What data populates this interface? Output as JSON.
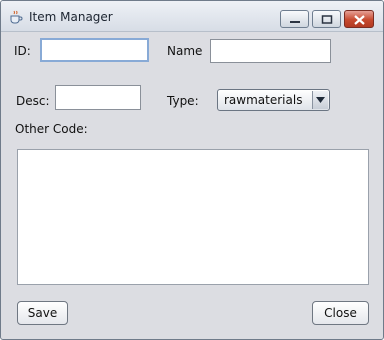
{
  "window": {
    "title": "Item Manager"
  },
  "form": {
    "id_label": "ID:",
    "id_value": "",
    "name_label": "Name",
    "name_value": "",
    "desc_label": "Desc:",
    "desc_value": "",
    "type_label": "Type:",
    "type_value": "rawmaterials",
    "other_code_label": "Other Code:",
    "other_code_value": ""
  },
  "buttons": {
    "save_label": "Save",
    "close_label": "Close"
  },
  "icons": {
    "app": "java-cup-icon",
    "minimize": "minimize-icon",
    "maximize": "maximize-icon",
    "close": "close-icon",
    "dropdown": "chevron-down-icon"
  },
  "colors": {
    "close_button": "#c7492f",
    "focus_border": "#88aad6",
    "window_bg": "#dcdde2"
  }
}
